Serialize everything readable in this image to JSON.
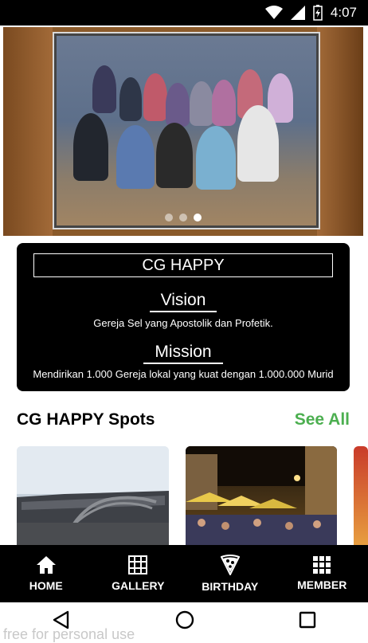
{
  "status_bar": {
    "time": "4:07"
  },
  "hero": {
    "slide_count": 3,
    "active_slide": 3
  },
  "info_card": {
    "title": "CG HAPPY",
    "vision_heading": "Vision",
    "vision_text": "Gereja Sel yang Apostolik dan Profetik.",
    "mission_heading": "Mission",
    "mission_text": "Mendirikan 1.000 Gereja lokal yang kuat dengan 1.000.000 Murid"
  },
  "spots": {
    "title": "CG HAPPY Spots",
    "see_all": "See All"
  },
  "bottom_nav": {
    "home": "HOME",
    "gallery": "GALLERY",
    "birthday": "BIRTHDAY",
    "member": "MEMBER"
  },
  "watermark": "free for personal use",
  "colors": {
    "accent": "#4caf50",
    "card_bg": "#000000"
  }
}
